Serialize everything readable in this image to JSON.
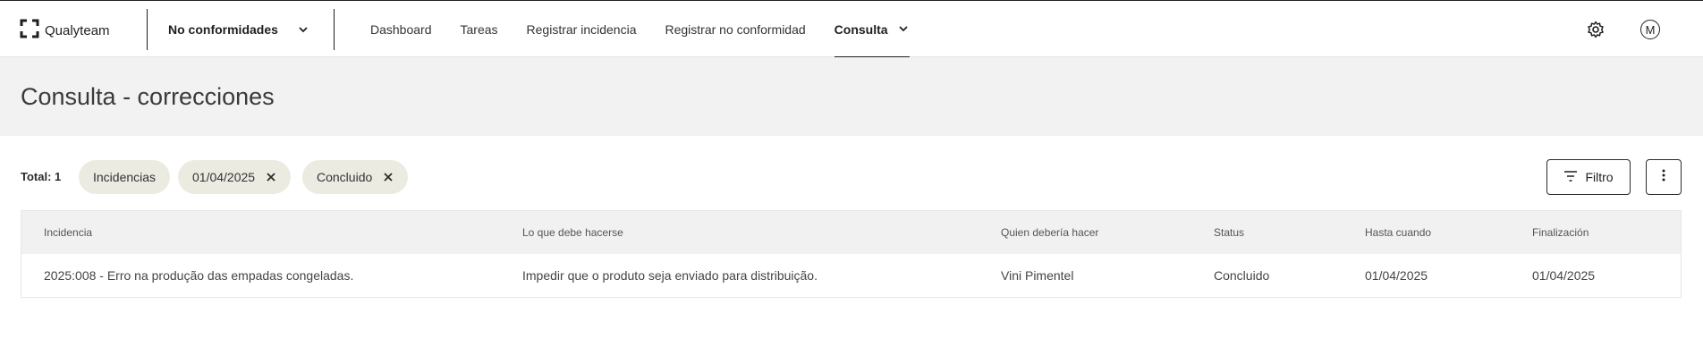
{
  "app": {
    "name": "Qualyteam"
  },
  "module_select": {
    "value": "No conformidades"
  },
  "nav": {
    "items": [
      {
        "label": "Dashboard"
      },
      {
        "label": "Tareas"
      },
      {
        "label": "Registrar incidencia"
      },
      {
        "label": "Registrar no conformidad"
      },
      {
        "label": "Consulta"
      }
    ],
    "active": "Consulta"
  },
  "user": {
    "avatar_initial": "M"
  },
  "page": {
    "title": "Consulta - correcciones"
  },
  "filters": {
    "total_label": "Total:",
    "total_value": "1",
    "chips": [
      {
        "label": "Incidencias",
        "removable": false
      },
      {
        "label": "01/04/2025",
        "removable": true
      },
      {
        "label": "Concluido",
        "removable": true
      }
    ],
    "filter_button": "Filtro"
  },
  "table": {
    "columns": [
      "Incidencia",
      "Lo que debe hacerse",
      "Quien debería hacer",
      "Status",
      "Hasta cuando",
      "Finalización"
    ],
    "rows": [
      [
        "2025:008 - Erro na produção das empadas congeladas.",
        "Impedir que o produto seja enviado para distribuição.",
        "Vini Pimentel",
        "Concluido",
        "01/04/2025",
        "01/04/2025"
      ]
    ]
  },
  "icons": {
    "logo": "bracket-frame-icon",
    "module_chevron": "chevron-down-icon",
    "nav_chevron": "chevron-down-icon",
    "settings": "gear-icon",
    "chip_remove": "close-icon",
    "filter": "filter-lines-icon",
    "more": "more-vertical-icon"
  },
  "colors": {
    "header_band": "#f2f2f2",
    "chip_bg": "#ecebe2",
    "active_underline": "#1f1f1f"
  }
}
